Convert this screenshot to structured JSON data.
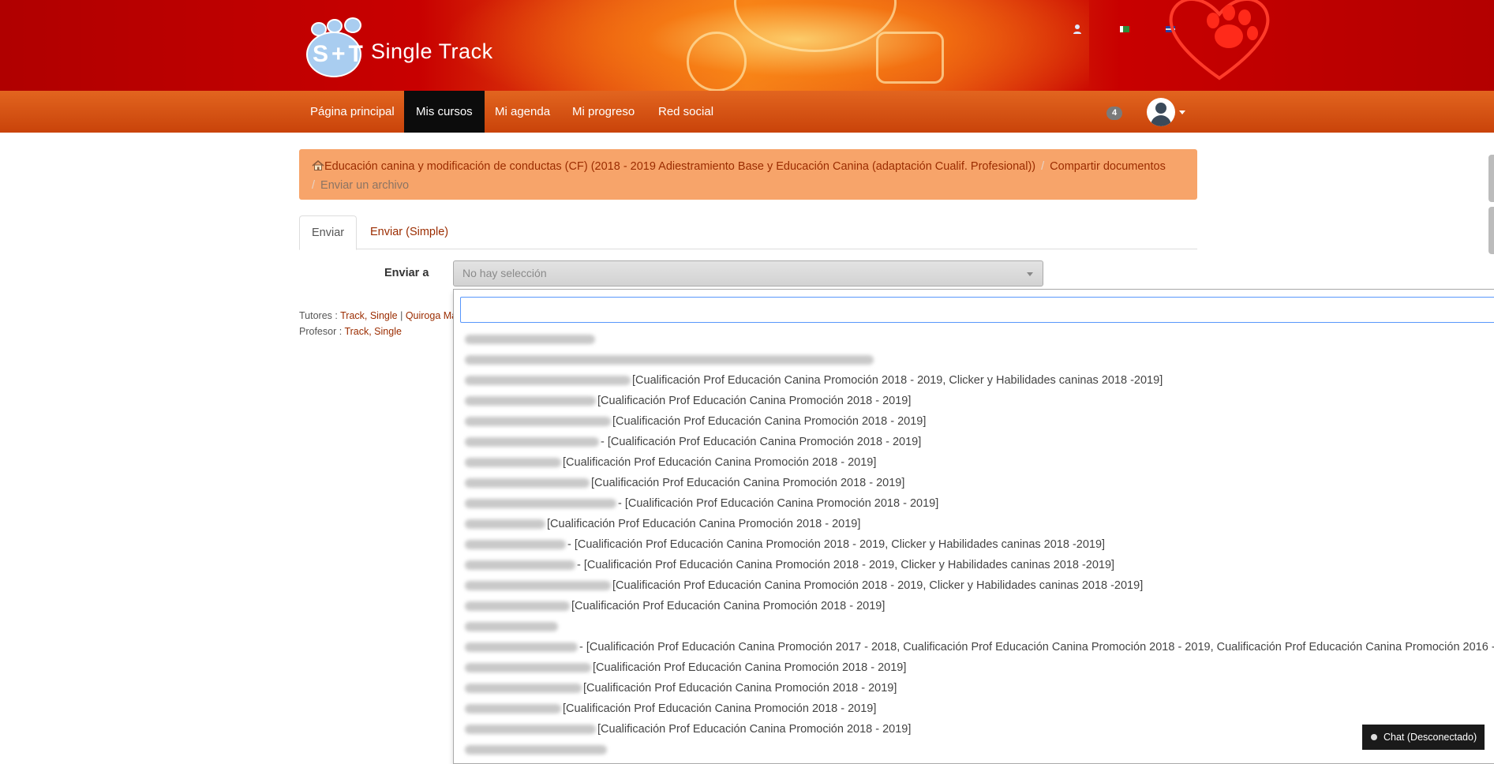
{
  "brand": {
    "name": "Single Track",
    "mark": "S+T"
  },
  "colors": {
    "banner": "#c80000",
    "navbar": "#d4521a",
    "breadcrumb_bg": "#f7a46a",
    "link": "#9b2c00"
  },
  "header": {
    "icons": [
      "user-icon",
      "flag-icon",
      "language-icon"
    ]
  },
  "nav": {
    "items": [
      {
        "label": "Página principal"
      },
      {
        "label": "Mis cursos"
      },
      {
        "label": "Mi agenda"
      },
      {
        "label": "Mi progreso"
      },
      {
        "label": "Red social"
      }
    ],
    "notifications": "4"
  },
  "breadcrumb": {
    "course": "Educación canina y modificación de conductas (CF) (2018 - 2019 Adiestramiento Base y Educación Canina (adaptación Cualif. Profesional))",
    "section": "Compartir documentos",
    "current": "Enviar un archivo",
    "separator": "/"
  },
  "tabs": [
    {
      "label": "Enviar"
    },
    {
      "label": "Enviar (Simple)"
    }
  ],
  "form": {
    "label": "Enviar a",
    "select_placeholder": "No hay selección"
  },
  "people": {
    "tutors_label": "Tutores :",
    "tutor1": "Track, Single",
    "pipe": "|",
    "tutor2": "Quiroga Ma",
    "teacher_label": "Profesor :",
    "teacher": "Track, Single"
  },
  "dropdown": {
    "options": [
      {
        "suffix": ""
      },
      {
        "suffix": ""
      },
      {
        "suffix": "[Cualificación Prof Educación Canina Promoción 2018 - 2019, Clicker y Habilidades caninas 2018 -2019]"
      },
      {
        "suffix": "[Cualificación Prof Educación Canina Promoción 2018 - 2019]"
      },
      {
        "suffix": "[Cualificación Prof Educación Canina Promoción 2018 - 2019]"
      },
      {
        "suffix": "- [Cualificación Prof Educación Canina Promoción 2018 - 2019]"
      },
      {
        "suffix": "[Cualificación Prof Educación Canina Promoción 2018 - 2019]"
      },
      {
        "suffix": "[Cualificación Prof Educación Canina Promoción 2018 - 2019]"
      },
      {
        "suffix": "- [Cualificación Prof Educación Canina Promoción 2018 - 2019]"
      },
      {
        "suffix": "[Cualificación Prof Educación Canina Promoción 2018 - 2019]"
      },
      {
        "suffix": "- [Cualificación Prof Educación Canina Promoción 2018 - 2019, Clicker y Habilidades caninas 2018 -2019]"
      },
      {
        "suffix": "- [Cualificación Prof Educación Canina Promoción 2018 - 2019, Clicker y Habilidades caninas 2018 -2019]"
      },
      {
        "suffix": "[Cualificación Prof Educación Canina Promoción 2018 - 2019, Clicker y Habilidades caninas 2018 -2019]"
      },
      {
        "suffix": "[Cualificación Prof Educación Canina Promoción 2018 - 2019]"
      },
      {
        "suffix": ""
      },
      {
        "suffix": "- [Cualificación Prof Educación Canina Promoción 2017 - 2018, Cualificación Prof Educación Canina Promoción 2018 - 2019, Cualificación Prof Educación Canina Promoción 2016 -"
      },
      {
        "suffix": "[Cualificación Prof Educación Canina Promoción 2018 - 2019]"
      },
      {
        "suffix": "[Cualificación Prof Educación Canina Promoción 2018 - 2019]"
      },
      {
        "suffix": "[Cualificación Prof Educación Canina Promoción 2018 - 2019]"
      },
      {
        "suffix": "[Cualificación Prof Educación Canina Promoción 2018 - 2019]"
      },
      {
        "suffix": ""
      }
    ]
  },
  "chat": {
    "label": "Chat (Desconectado)"
  }
}
